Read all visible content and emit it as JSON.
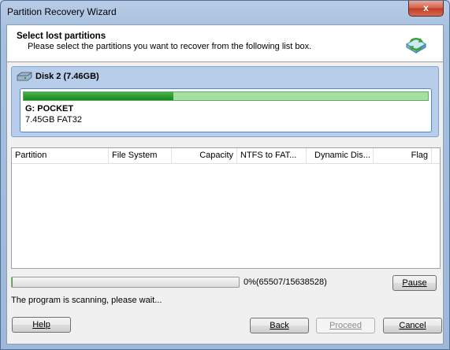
{
  "window": {
    "title": "Partition Recovery Wizard",
    "close_glyph": "x"
  },
  "header": {
    "title": "Select lost partitions",
    "subtitle": "Please select the partitions you want to recover from the following list box.",
    "icon": "recovery-wizard-icon"
  },
  "disk": {
    "label": "Disk 2 (7.46GB)",
    "icon": "disk-icon",
    "partition": {
      "name": "G: POCKET",
      "info": "7.45GB FAT32",
      "used_fraction": 0.37
    }
  },
  "list": {
    "columns": [
      "Partition",
      "File System",
      "Capacity",
      "NTFS to FAT...",
      "Dynamic Dis...",
      "Flag"
    ],
    "rows": []
  },
  "scan": {
    "progress_fraction": 0.0042,
    "progress_text": "0%(65507/15638528)",
    "pause_label": "Pause",
    "status": "The program is scanning, please wait..."
  },
  "footer": {
    "help_label": "Help",
    "back_label": "Back",
    "proceed_label": "Proceed",
    "cancel_label": "Cancel"
  },
  "colors": {
    "accent_green": "#168a1e",
    "disk_panel": "#b8cdea",
    "close_red": "#c23a22"
  }
}
